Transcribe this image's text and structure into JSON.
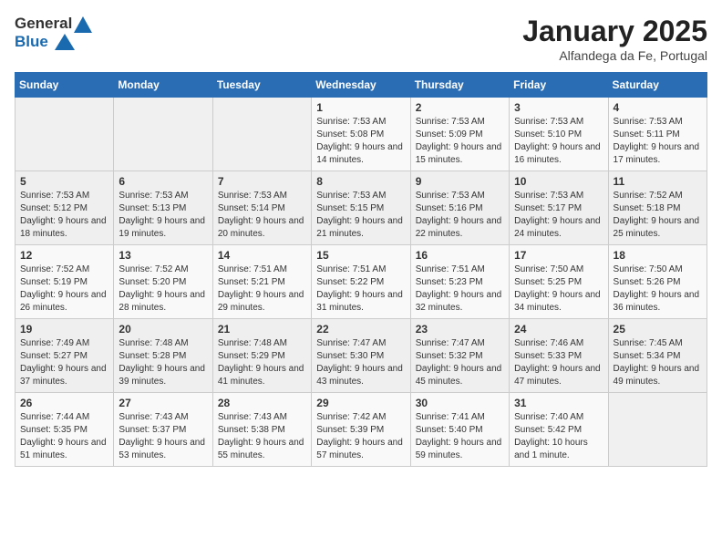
{
  "header": {
    "logo_line1": "General",
    "logo_line2": "Blue",
    "title": "January 2025",
    "subtitle": "Alfandega da Fe, Portugal"
  },
  "weekdays": [
    "Sunday",
    "Monday",
    "Tuesday",
    "Wednesday",
    "Thursday",
    "Friday",
    "Saturday"
  ],
  "weeks": [
    [
      {
        "day": "",
        "sunrise": "",
        "sunset": "",
        "daylight": ""
      },
      {
        "day": "",
        "sunrise": "",
        "sunset": "",
        "daylight": ""
      },
      {
        "day": "",
        "sunrise": "",
        "sunset": "",
        "daylight": ""
      },
      {
        "day": "1",
        "sunrise": "Sunrise: 7:53 AM",
        "sunset": "Sunset: 5:08 PM",
        "daylight": "Daylight: 9 hours and 14 minutes."
      },
      {
        "day": "2",
        "sunrise": "Sunrise: 7:53 AM",
        "sunset": "Sunset: 5:09 PM",
        "daylight": "Daylight: 9 hours and 15 minutes."
      },
      {
        "day": "3",
        "sunrise": "Sunrise: 7:53 AM",
        "sunset": "Sunset: 5:10 PM",
        "daylight": "Daylight: 9 hours and 16 minutes."
      },
      {
        "day": "4",
        "sunrise": "Sunrise: 7:53 AM",
        "sunset": "Sunset: 5:11 PM",
        "daylight": "Daylight: 9 hours and 17 minutes."
      }
    ],
    [
      {
        "day": "5",
        "sunrise": "Sunrise: 7:53 AM",
        "sunset": "Sunset: 5:12 PM",
        "daylight": "Daylight: 9 hours and 18 minutes."
      },
      {
        "day": "6",
        "sunrise": "Sunrise: 7:53 AM",
        "sunset": "Sunset: 5:13 PM",
        "daylight": "Daylight: 9 hours and 19 minutes."
      },
      {
        "day": "7",
        "sunrise": "Sunrise: 7:53 AM",
        "sunset": "Sunset: 5:14 PM",
        "daylight": "Daylight: 9 hours and 20 minutes."
      },
      {
        "day": "8",
        "sunrise": "Sunrise: 7:53 AM",
        "sunset": "Sunset: 5:15 PM",
        "daylight": "Daylight: 9 hours and 21 minutes."
      },
      {
        "day": "9",
        "sunrise": "Sunrise: 7:53 AM",
        "sunset": "Sunset: 5:16 PM",
        "daylight": "Daylight: 9 hours and 22 minutes."
      },
      {
        "day": "10",
        "sunrise": "Sunrise: 7:53 AM",
        "sunset": "Sunset: 5:17 PM",
        "daylight": "Daylight: 9 hours and 24 minutes."
      },
      {
        "day": "11",
        "sunrise": "Sunrise: 7:52 AM",
        "sunset": "Sunset: 5:18 PM",
        "daylight": "Daylight: 9 hours and 25 minutes."
      }
    ],
    [
      {
        "day": "12",
        "sunrise": "Sunrise: 7:52 AM",
        "sunset": "Sunset: 5:19 PM",
        "daylight": "Daylight: 9 hours and 26 minutes."
      },
      {
        "day": "13",
        "sunrise": "Sunrise: 7:52 AM",
        "sunset": "Sunset: 5:20 PM",
        "daylight": "Daylight: 9 hours and 28 minutes."
      },
      {
        "day": "14",
        "sunrise": "Sunrise: 7:51 AM",
        "sunset": "Sunset: 5:21 PM",
        "daylight": "Daylight: 9 hours and 29 minutes."
      },
      {
        "day": "15",
        "sunrise": "Sunrise: 7:51 AM",
        "sunset": "Sunset: 5:22 PM",
        "daylight": "Daylight: 9 hours and 31 minutes."
      },
      {
        "day": "16",
        "sunrise": "Sunrise: 7:51 AM",
        "sunset": "Sunset: 5:23 PM",
        "daylight": "Daylight: 9 hours and 32 minutes."
      },
      {
        "day": "17",
        "sunrise": "Sunrise: 7:50 AM",
        "sunset": "Sunset: 5:25 PM",
        "daylight": "Daylight: 9 hours and 34 minutes."
      },
      {
        "day": "18",
        "sunrise": "Sunrise: 7:50 AM",
        "sunset": "Sunset: 5:26 PM",
        "daylight": "Daylight: 9 hours and 36 minutes."
      }
    ],
    [
      {
        "day": "19",
        "sunrise": "Sunrise: 7:49 AM",
        "sunset": "Sunset: 5:27 PM",
        "daylight": "Daylight: 9 hours and 37 minutes."
      },
      {
        "day": "20",
        "sunrise": "Sunrise: 7:48 AM",
        "sunset": "Sunset: 5:28 PM",
        "daylight": "Daylight: 9 hours and 39 minutes."
      },
      {
        "day": "21",
        "sunrise": "Sunrise: 7:48 AM",
        "sunset": "Sunset: 5:29 PM",
        "daylight": "Daylight: 9 hours and 41 minutes."
      },
      {
        "day": "22",
        "sunrise": "Sunrise: 7:47 AM",
        "sunset": "Sunset: 5:30 PM",
        "daylight": "Daylight: 9 hours and 43 minutes."
      },
      {
        "day": "23",
        "sunrise": "Sunrise: 7:47 AM",
        "sunset": "Sunset: 5:32 PM",
        "daylight": "Daylight: 9 hours and 45 minutes."
      },
      {
        "day": "24",
        "sunrise": "Sunrise: 7:46 AM",
        "sunset": "Sunset: 5:33 PM",
        "daylight": "Daylight: 9 hours and 47 minutes."
      },
      {
        "day": "25",
        "sunrise": "Sunrise: 7:45 AM",
        "sunset": "Sunset: 5:34 PM",
        "daylight": "Daylight: 9 hours and 49 minutes."
      }
    ],
    [
      {
        "day": "26",
        "sunrise": "Sunrise: 7:44 AM",
        "sunset": "Sunset: 5:35 PM",
        "daylight": "Daylight: 9 hours and 51 minutes."
      },
      {
        "day": "27",
        "sunrise": "Sunrise: 7:43 AM",
        "sunset": "Sunset: 5:37 PM",
        "daylight": "Daylight: 9 hours and 53 minutes."
      },
      {
        "day": "28",
        "sunrise": "Sunrise: 7:43 AM",
        "sunset": "Sunset: 5:38 PM",
        "daylight": "Daylight: 9 hours and 55 minutes."
      },
      {
        "day": "29",
        "sunrise": "Sunrise: 7:42 AM",
        "sunset": "Sunset: 5:39 PM",
        "daylight": "Daylight: 9 hours and 57 minutes."
      },
      {
        "day": "30",
        "sunrise": "Sunrise: 7:41 AM",
        "sunset": "Sunset: 5:40 PM",
        "daylight": "Daylight: 9 hours and 59 minutes."
      },
      {
        "day": "31",
        "sunrise": "Sunrise: 7:40 AM",
        "sunset": "Sunset: 5:42 PM",
        "daylight": "Daylight: 10 hours and 1 minute."
      },
      {
        "day": "",
        "sunrise": "",
        "sunset": "",
        "daylight": ""
      }
    ]
  ]
}
